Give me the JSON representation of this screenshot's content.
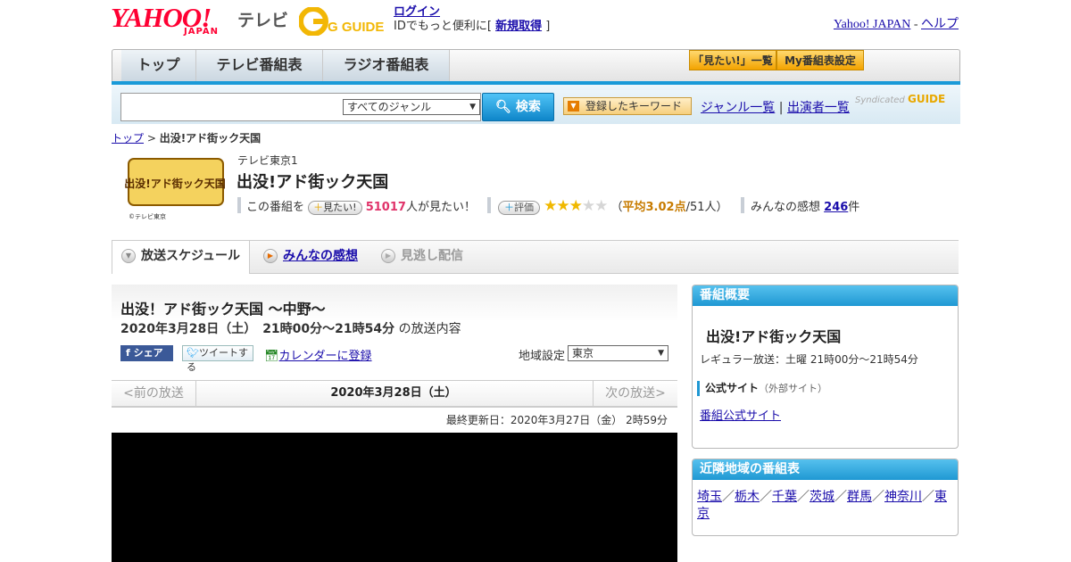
{
  "header": {
    "yahoo_logo": "YAHOO!",
    "yahoo_japan": "JAPAN",
    "tv_label": "テレビ",
    "gguide_logo": "G GUIDE",
    "login_link": "ログイン",
    "login_text_pre": "IDでもっと便利に[ ",
    "register_link": "新規取得",
    "login_text_post": " ]",
    "yahoo_japan_link": "Yahoo! JAPAN",
    "link_sep": " - ",
    "help_link": "ヘルプ"
  },
  "nav": {
    "tabs": [
      "トップ",
      "テレビ番組表",
      "ラジオ番組表"
    ],
    "mitai_list_button": "「見たい!」一覧",
    "my_schedule_button": "My番組表設定"
  },
  "search": {
    "input_value": "",
    "genre_selected": "すべてのジャンル",
    "search_button": "検索",
    "keyword_button": "登録したキーワード",
    "genre_list_link": "ジャンル一覧",
    "divider": "|",
    "performer_list_link": "出演者一覧",
    "syndicated": "Syndicated",
    "gguide": "GUIDE"
  },
  "breadcrumb": {
    "top": "トップ",
    "sep": " > ",
    "current": "出没!アド街ック天国"
  },
  "program": {
    "logo_text": "出没!アド街ック天国",
    "logo_copy": "©テレビ東京",
    "channel": "テレビ東京1",
    "title": "出没!アド街ック天国",
    "mitai_pre": "この番組を",
    "mitai_button": "見たい!",
    "mitai_count": "51017",
    "mitai_post": "人が見たい！",
    "hyoka_button": "評価",
    "stars_on": "★★★",
    "stars_off": "★★",
    "avg_pre": "（",
    "avg": "平均3.02点",
    "avg_post": "/51人）",
    "kansou_pre": "みんなの感想",
    "kansou_count": "246",
    "kansou_post": "件"
  },
  "tabs": {
    "schedule": "放送スケジュール",
    "kansou": "みんなの感想",
    "minogashi": "見逃し配信"
  },
  "episode": {
    "title": "出没！アド街ック天国 ～中野～",
    "date": "2020年3月28日（土）　21時00分～21時54分",
    "date_suffix": "の放送内容",
    "share_button": "シェア",
    "tweet_button": "ツイートする",
    "calendar_link": "カレンダーに登録",
    "region_label": "地域設定",
    "region_selected": "東京",
    "prev": "<前の放送",
    "current_date": "2020年3月28日（土）",
    "next": "次の放送>",
    "updated": "最終更新日：2020年3月27日（金） 2時59分"
  },
  "sidebar": {
    "overview_head": "番組概要",
    "title": "出没!アド街ック天国",
    "regular": "レギュラー放送：土曜 21時00分～21時54分",
    "official_label": "公式サイト",
    "official_note": "（外部サイト）",
    "official_link": "番組公式サイト",
    "nearby_head": "近隣地域の番組表",
    "nearby": [
      "埼玉",
      "栃木",
      "千葉",
      "茨城",
      "群馬",
      "神奈川",
      "東京"
    ],
    "nearby_sep": "／"
  }
}
